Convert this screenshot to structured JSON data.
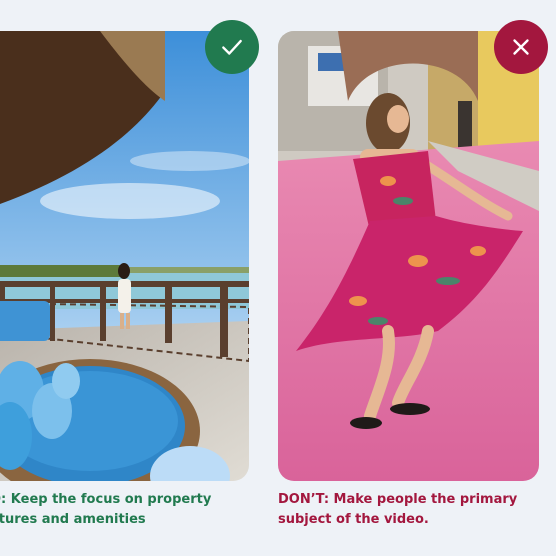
{
  "do": {
    "badge_icon": "checkmark-icon",
    "badge_color": "#217a4f",
    "caption_line1": "O: Keep the focus on property",
    "caption_line2": "atures and amenities"
  },
  "dont": {
    "badge_icon": "close-x-icon",
    "badge_color": "#a3173e",
    "caption_line1": "DON’T: Make people the primary",
    "caption_line2": "subject of the video."
  }
}
